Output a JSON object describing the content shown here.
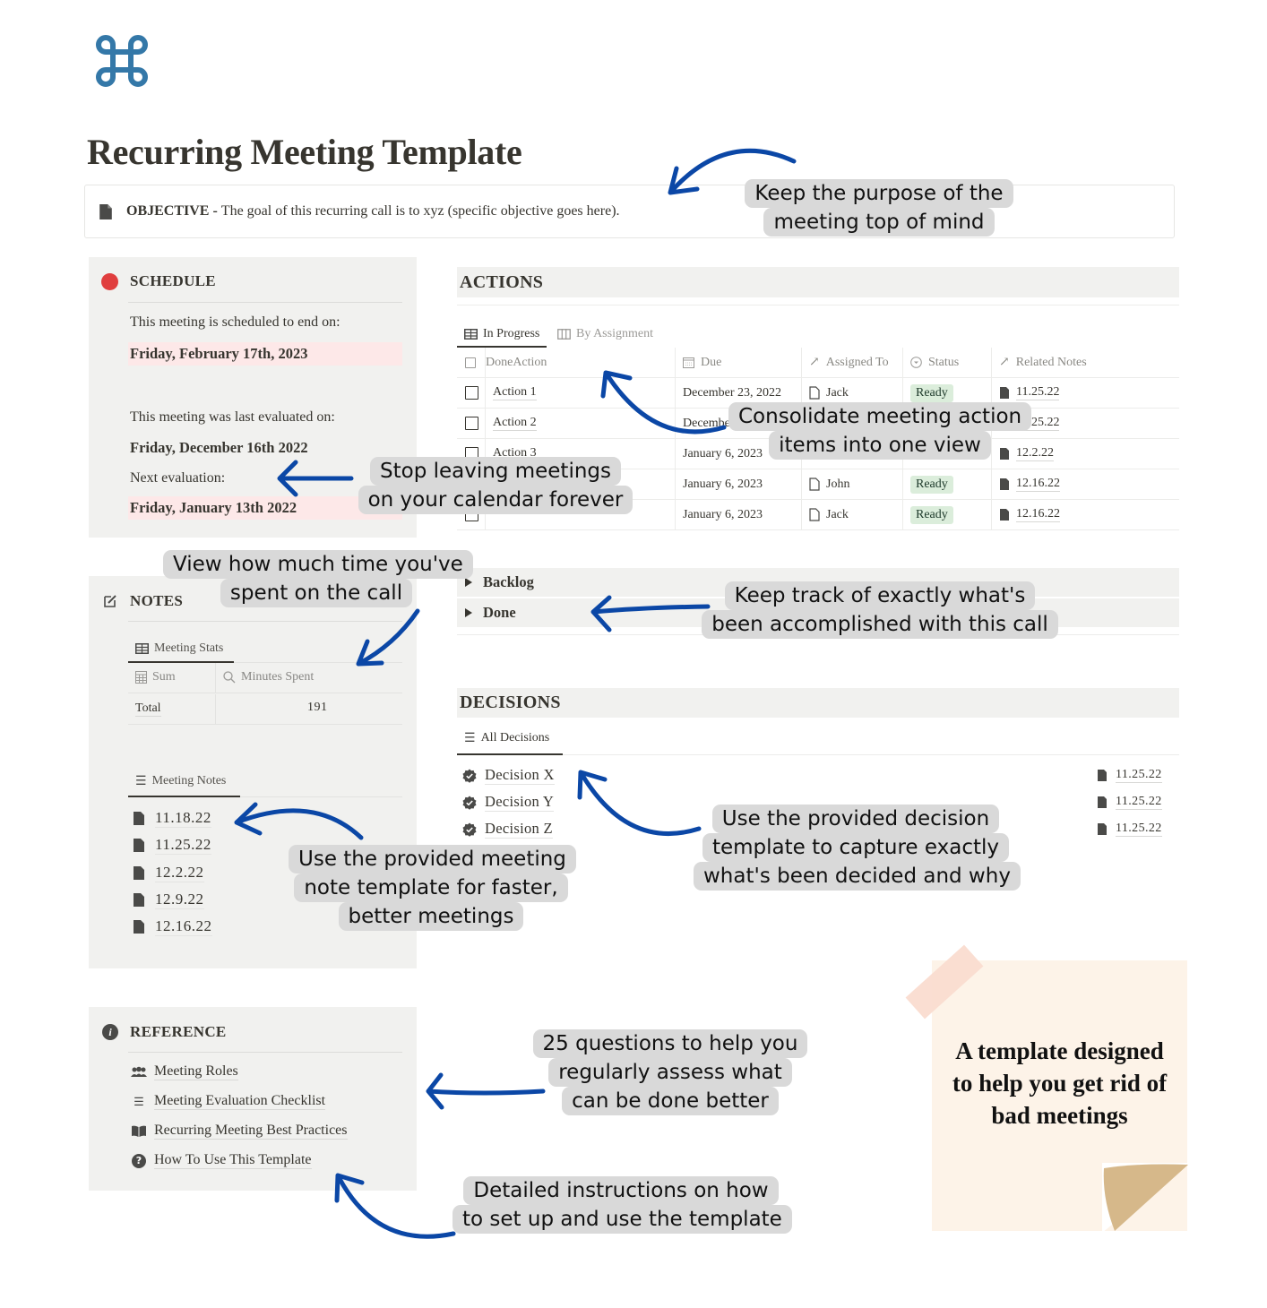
{
  "page": {
    "title": "Recurring Meeting Template",
    "logo_icon": "command-key-icon",
    "objective": {
      "label": "OBJECTIVE -",
      "text": "The goal of this recurring call is to xyz (specific objective goes here)."
    }
  },
  "schedule": {
    "heading": "SCHEDULE",
    "end_label": "This meeting is scheduled to end on:",
    "end_date": "Friday, February 17th, 2023",
    "last_eval_label": "This meeting was last evaluated on:",
    "last_eval_date": "Friday, December 16th 2022",
    "next_eval_label": "Next evaluation:",
    "next_eval_date": "Friday, January 13th 2022",
    "accent_color": "#e03e3e"
  },
  "notes": {
    "heading": "NOTES",
    "stats_tab": "Meeting Stats",
    "stats_columns": [
      "Sum",
      "Minutes Spent"
    ],
    "stats_row": {
      "label": "Total",
      "value": "191"
    },
    "notes_tab": "Meeting Notes",
    "items": [
      "11.18.22",
      "11.25.22",
      "12.2.22",
      "12.9.22",
      "12.16.22"
    ]
  },
  "reference": {
    "heading": "REFERENCE",
    "items": [
      {
        "icon": "people-icon",
        "label": "Meeting Roles"
      },
      {
        "icon": "list-icon",
        "label": "Meeting Evaluation Checklist"
      },
      {
        "icon": "book-icon",
        "label": "Recurring Meeting Best Practices"
      },
      {
        "icon": "question-icon",
        "label": "How To Use This Template"
      }
    ]
  },
  "actions": {
    "heading": "ACTIONS",
    "tabs": [
      "In Progress",
      "By Assignment"
    ],
    "columns": [
      "DoneAction",
      "Due",
      "Assigned To",
      "Status",
      "Related Notes"
    ],
    "rows": [
      {
        "action": "Action 1",
        "due": "December 23, 2022",
        "assigned": "Jack",
        "status": "Ready",
        "note": "11.25.22"
      },
      {
        "action": "Action 2",
        "due": "December 23, 2022",
        "assigned": "",
        "status": "",
        "note": "11.25.22"
      },
      {
        "action": "Action 3",
        "due": "January 6, 2023",
        "assigned": "",
        "status": "",
        "note": "12.2.22"
      },
      {
        "action": "",
        "due": "January 6, 2023",
        "assigned": "John",
        "status": "Ready",
        "note": "12.16.22"
      },
      {
        "action": "",
        "due": "January 6, 2023",
        "assigned": "Jack",
        "status": "Ready",
        "note": "12.16.22"
      }
    ],
    "groups": [
      "Backlog",
      "Done"
    ],
    "status_color": "#dbeddb"
  },
  "decisions": {
    "heading": "DECISIONS",
    "tab": "All Decisions",
    "items": [
      {
        "label": "Decision X",
        "note": "11.25.22"
      },
      {
        "label": "Decision Y",
        "note": "11.25.22"
      },
      {
        "label": "Decision Z",
        "note": "11.25.22"
      }
    ]
  },
  "callouts": {
    "objective": [
      "Keep the purpose of the",
      "meeting top of mind"
    ],
    "actions": [
      "Consolidate meeting action",
      "items into one view"
    ],
    "schedule": [
      "Stop leaving meetings",
      "on your calendar forever"
    ],
    "stats": [
      "View how much time you've",
      "spent on the call"
    ],
    "done": [
      "Keep track of exactly what's",
      "been accomplished with this call"
    ],
    "notes": [
      "Use the provided meeting",
      "note template for faster,",
      "better meetings"
    ],
    "decisions": [
      "Use the provided decision",
      "template to capture exactly",
      "what's been decided and why"
    ],
    "checklist": [
      "25 questions to help you",
      "regularly assess what",
      "can be done better"
    ],
    "howto": [
      "Detailed instructions on how",
      "to set up and use the template"
    ],
    "arrow_color": "#0b47a6"
  },
  "sticky_note": {
    "lines": [
      "A template designed",
      "to help you get rid of",
      "bad meetings"
    ]
  }
}
